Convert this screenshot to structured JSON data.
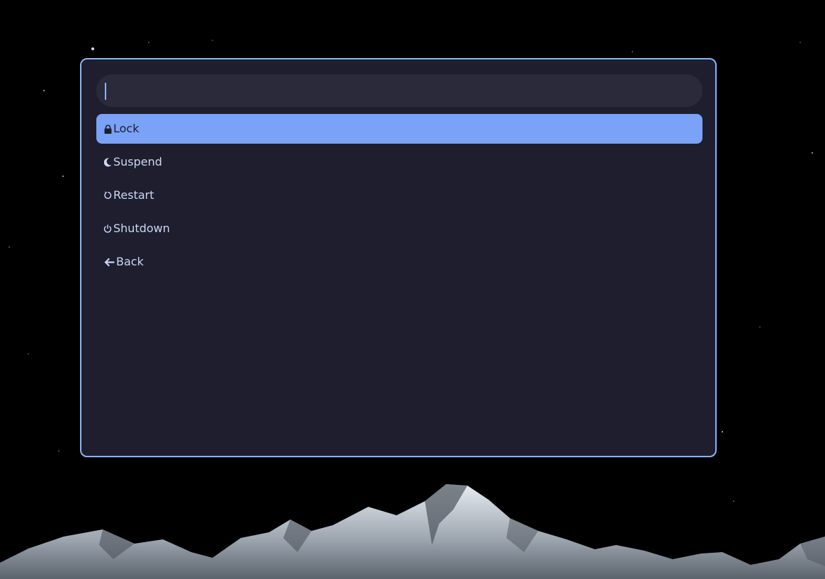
{
  "launcher": {
    "search": {
      "value": "",
      "placeholder": ""
    },
    "items": [
      {
        "label": "Lock",
        "icon": "lock-icon",
        "selected": true
      },
      {
        "label": "Suspend",
        "icon": "moon-icon",
        "selected": false
      },
      {
        "label": "Restart",
        "icon": "restart-icon",
        "selected": false
      },
      {
        "label": "Shutdown",
        "icon": "power-icon",
        "selected": false
      },
      {
        "label": "Back",
        "icon": "arrow-left-icon",
        "selected": false
      }
    ]
  },
  "colors": {
    "background": "#000000",
    "panel": "#1e1e2e",
    "border": "#89b4fa",
    "search_bg": "#2a2a3a",
    "selected_bg": "#7aa2f7",
    "text": "#cdd6f4",
    "selected_text": "#1e1e2e"
  }
}
